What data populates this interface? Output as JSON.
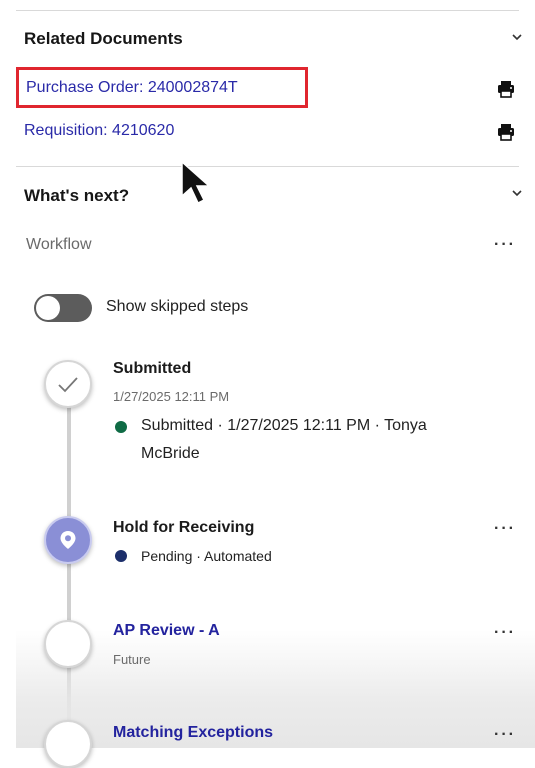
{
  "related_documents": {
    "title": "Related Documents",
    "items": [
      {
        "label": "Purchase Order: 240002874T",
        "icon": "printer-icon"
      },
      {
        "label": "Requisition: 4210620",
        "icon": "printer-icon"
      }
    ]
  },
  "whats_next": {
    "title": "What's next?",
    "workflow_label": "Workflow",
    "more_label": "···",
    "toggle": {
      "label": "Show skipped steps",
      "checked": false
    }
  },
  "steps": [
    {
      "title": "Submitted",
      "timestamp": "1/27/2025 12:11 PM",
      "status_line1": "Submitted · 1/27/2025 12:11 PM · Tonya",
      "status_line2": "McBride",
      "dot_color": "#0f6b45",
      "icon": "checkmark-icon"
    },
    {
      "title": "Hold for Receiving",
      "status": "Pending · Automated",
      "dot_color": "#1c2f6b",
      "icon": "location-pin-icon",
      "circle_color": "#8a8fd6",
      "more_label": "···"
    },
    {
      "title": "AP Review - A",
      "status": "Future",
      "more_label": "···"
    },
    {
      "title": "Matching Exceptions",
      "more_label": "···"
    }
  ],
  "colors": {
    "link": "#2a2aa8",
    "highlight": "#e0262f",
    "timeline_line": "#d0d0d0"
  }
}
